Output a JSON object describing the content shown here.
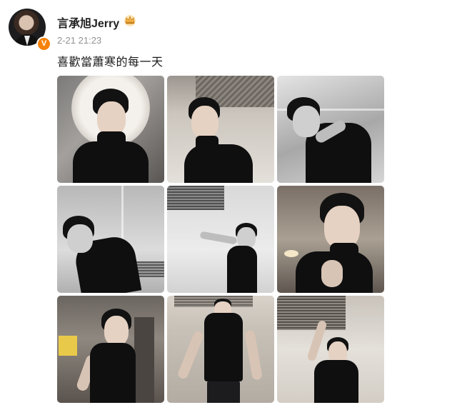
{
  "post": {
    "username": "言承旭Jerry",
    "timestamp": "2-21 21:23",
    "verified_badge": "V",
    "text": "喜歡當蕭寒的每一天"
  },
  "icons": {
    "crown": "crown-icon",
    "verified": "verified-badge-icon"
  },
  "colors": {
    "badge": "#f5820b",
    "timestamp": "#939393",
    "crown": "#f5b54a"
  },
  "photos": [
    {
      "id": 1,
      "subject": "portrait with black turtleneck, bright round window"
    },
    {
      "id": 2,
      "subject": "laughing, ceiling vents"
    },
    {
      "id": 3,
      "subject": "black and white, hand at collar"
    },
    {
      "id": 4,
      "subject": "black and white, leaning pose"
    },
    {
      "id": 5,
      "subject": "black and white, arm extended"
    },
    {
      "id": 6,
      "subject": "close-up portrait, garage"
    },
    {
      "id": 7,
      "subject": "standing in parking garage"
    },
    {
      "id": 8,
      "subject": "full figure under ceiling"
    },
    {
      "id": 9,
      "subject": "arm raised to ceiling vent"
    }
  ]
}
